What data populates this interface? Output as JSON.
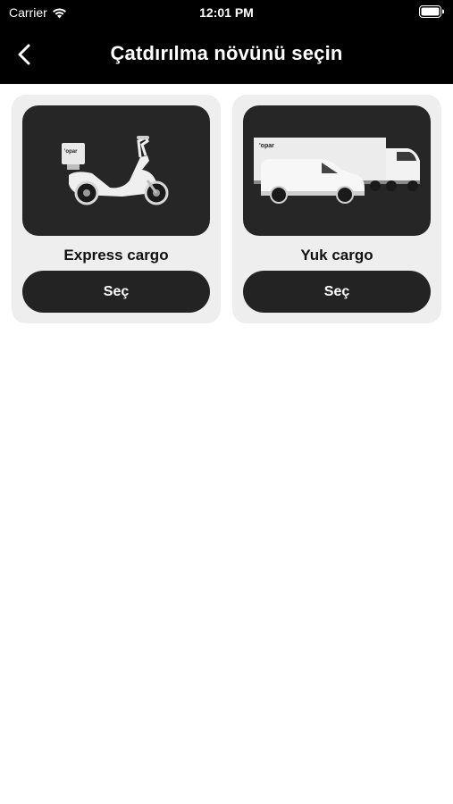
{
  "status_bar": {
    "carrier": "Carrier",
    "time": "12:01 PM"
  },
  "nav": {
    "title": "Çatdırılma növünü seçin"
  },
  "options": [
    {
      "name": "Express cargo",
      "button_label": "Seç",
      "icon": "scooter-icon",
      "brand": "opar"
    },
    {
      "name": "Yuk cargo",
      "button_label": "Seç",
      "icon": "truck-van-icon",
      "brand": "opar"
    }
  ],
  "colors": {
    "bar": "#000000",
    "card_bg": "#eeeeee",
    "image_bg": "#262626",
    "button_bg": "#232323"
  }
}
